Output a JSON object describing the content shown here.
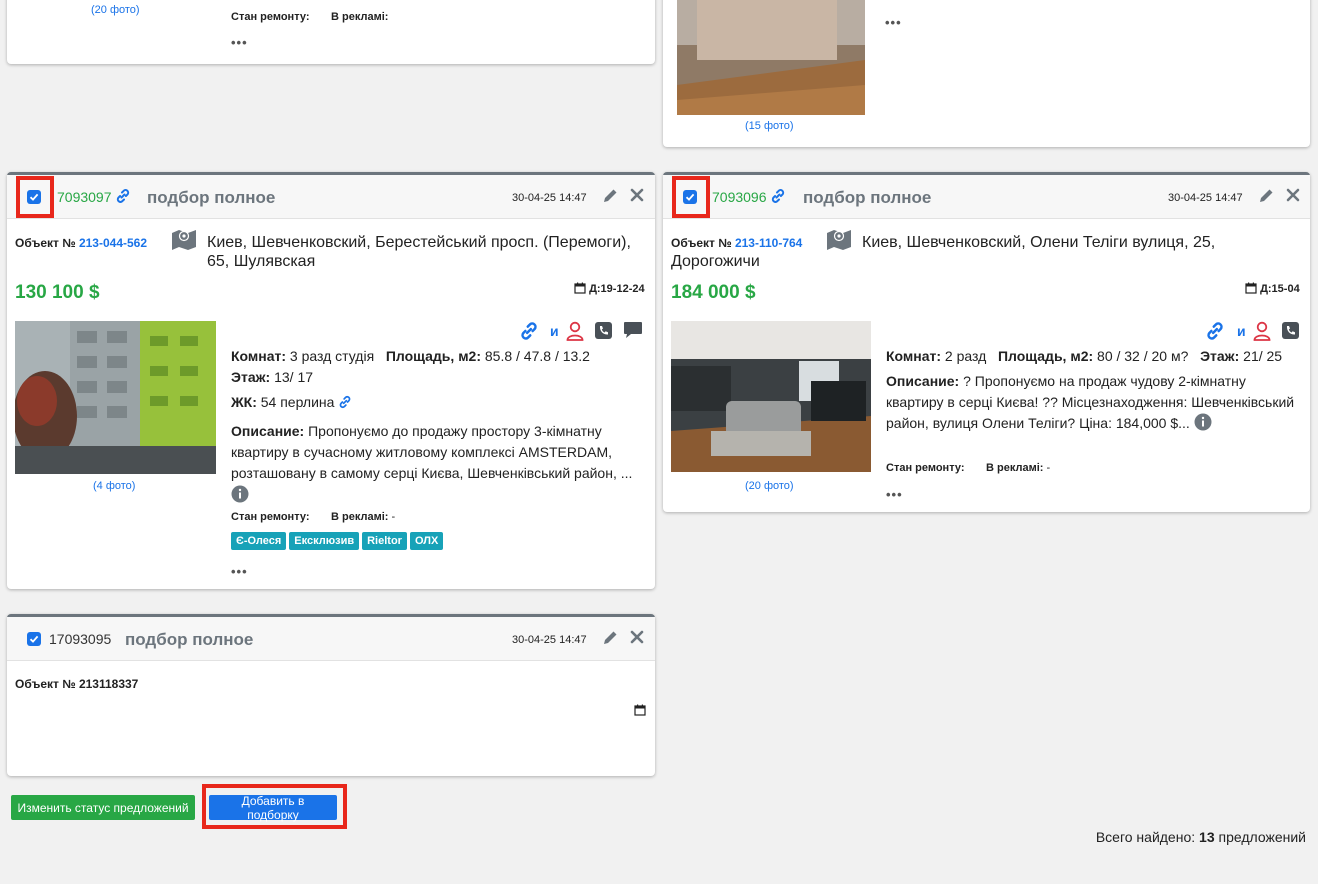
{
  "top_left": {
    "photos_link": "(20 фото)",
    "repair_label": "Стан ремонту:",
    "ads_label": "В рекламі:",
    "more": "•••"
  },
  "top_right": {
    "photos_link": "(15 фото)",
    "more": "•••"
  },
  "card1": {
    "id": "7093097",
    "title": "подбор полное",
    "date": "30-04-25 14:47",
    "object_label": "Объект №",
    "object_id": "213-044-562",
    "address": "Киев, Шевченковский, Берестейський просп. (Перемоги), 65, Шулявская",
    "price": "130 100 $",
    "date_code": "Д:19-12-24",
    "and_label": "и",
    "rooms_label": "Комнат:",
    "rooms_value": "3 разд студія",
    "area_label": "Площадь, м2:",
    "area_value": "85.8 / 47.8 / 13.2",
    "floor_label": "Этаж:",
    "floor_value": "13/ 17",
    "complex_label": "ЖК:",
    "complex_value": "54 перлина",
    "desc_label": "Описание:",
    "desc_value": "Пропонуємо до продажу простору 3-кімнатну квартиру в сучасному житловому комплексі AMSTERDAM, розташовану в самому серці Києва, Шевченківський район, ...",
    "repair_label": "Стан ремонту:",
    "ads_label": "В рекламі:",
    "ads_value": "-",
    "photos_link": "(4 фото)",
    "tags": [
      "Є-Олеся",
      "Ексклюзив",
      "Rieltor",
      "ОЛХ"
    ],
    "more": "•••"
  },
  "card2": {
    "id": "7093096",
    "title": "подбор полное",
    "date": "30-04-25 14:47",
    "object_label": "Объект №",
    "object_id": "213-110-764",
    "address": "Киев, Шевченковский, Олени Теліги вулиця, 25, Дорогожичи",
    "price": "184 000 $",
    "date_code": "Д:15-04",
    "and_label": "и",
    "rooms_label": "Комнат:",
    "rooms_value": "2 разд",
    "area_label": "Площадь, м2:",
    "area_value": "80 / 32 / 20 м?",
    "floor_label": "Этаж:",
    "floor_value": "21/ 25",
    "desc_label": "Описание:",
    "desc_value": "? Пропонуємо на продаж чудову 2-кімнатну квартиру в серці Києва! ?? Місцезнаходження: Шевченківський район, вулиця Олени Теліги? Ціна: 184,000 $...",
    "repair_label": "Стан ремонту:",
    "ads_label": "В рекламі:",
    "ads_value": "-",
    "photos_link": "(20 фото)",
    "more": "•••"
  },
  "card3": {
    "id": "17093095",
    "title": "подбор полное",
    "date": "30-04-25 14:47",
    "object_text": "Объект № 213118337"
  },
  "footer": {
    "change_status_button": "Изменить статус предложений",
    "add_button": "Добавить в подборку",
    "total_label": "Всего найдено:",
    "total_count": "13",
    "total_suffix": "предложений"
  },
  "colors": {
    "green": "#28a745",
    "link_blue": "#1a73e8",
    "highlight_red": "#e8271b",
    "tag_teal": "#17a2b8",
    "primary_button": "#1a73e8",
    "success_button": "#28a745"
  }
}
